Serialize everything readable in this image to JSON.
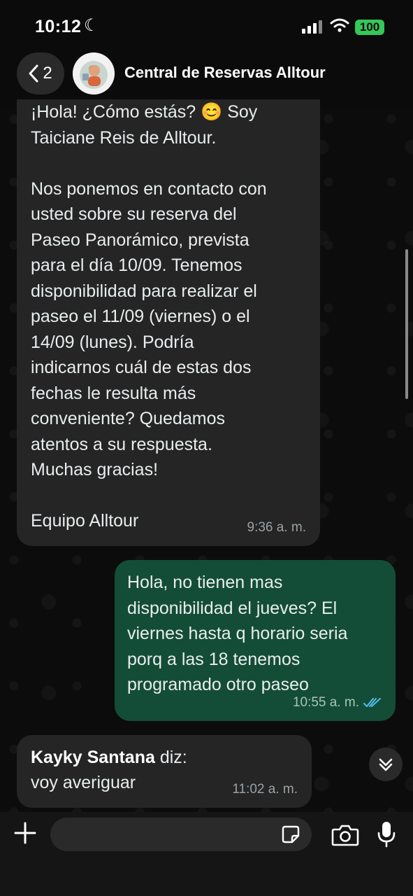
{
  "status": {
    "time": "10:12",
    "battery": "100"
  },
  "header": {
    "back_count": "2",
    "title": "Central de Reservas Alltour"
  },
  "messages": [
    {
      "text": "¡Hola! ¿Cómo estás? 😊 Soy\nTaiciane Reis de Alltour.\n\nNos ponemos en contacto con\nusted sobre su reserva del\nPaseo Panorámico, prevista\npara el día 10/09. Tenemos\ndisponibilidad para realizar el\npaseo el 11/09 (viernes) o el\n14/09 (lunes). Podría\nindicarnos cuál de estas dos\nfechas le resulta más\nconveniente? Quedamos\natentos a su respuesta.\nMuchas gracias!\n\nEquipo Alltour",
      "time": "9:36 a. m."
    },
    {
      "text": "Hola, no tienen mas\ndisponibilidad el jueves? El\nviernes hasta q horario seria\nporq a las 18 tenemos\nprogramado otro paseo",
      "time": "10:55 a. m."
    },
    {
      "sender": "Kayky Santana",
      "sender_suffix": " diz:",
      "text": "voy averiguar",
      "time": "11:02 a. m."
    }
  ],
  "icons": {
    "back": "chevron-left-icon",
    "moon": "moon-icon",
    "read": "double-check-icon",
    "scroll": "double-chevron-down-icon",
    "plus": "plus-icon",
    "sticker": "sticker-icon",
    "camera": "camera-icon",
    "mic": "microphone-icon"
  },
  "colors": {
    "incoming": "#252525",
    "outgoing": "#144d37",
    "read_check": "#53bdeb",
    "battery": "#35c759"
  }
}
